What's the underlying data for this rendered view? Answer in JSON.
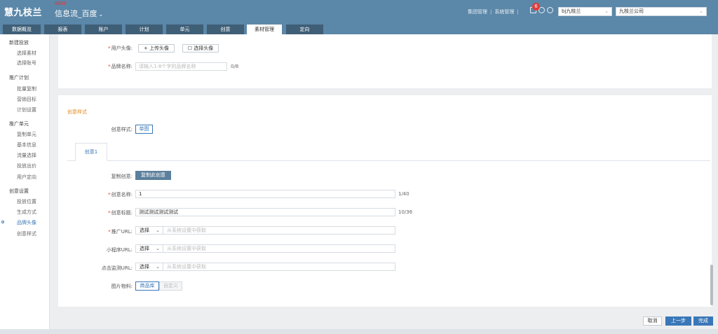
{
  "header": {
    "logo": "慧九枝兰",
    "hot_badge": "NEW",
    "product": "信息流_百度",
    "links": [
      "集团管理",
      "系统管理"
    ],
    "notification_count": "6",
    "account_select": "bj九枝兰",
    "company_select": "九枝兰公司"
  },
  "tabs": [
    "数据概览",
    "报表",
    "账户",
    "计划",
    "单元",
    "创意",
    "素材管理",
    "定向"
  ],
  "active_tab": "素材管理",
  "sidebar": {
    "groups": [
      {
        "label": "新建投放",
        "children": [
          "选择素材",
          "选择账号"
        ]
      },
      {
        "label": "推广计划",
        "children": [
          "批量复制",
          "营销目标",
          "计划设置"
        ]
      },
      {
        "label": "推广单元",
        "children": [
          "复制单元",
          "基本信息",
          "流量选择",
          "投放出价",
          "用户定向"
        ]
      },
      {
        "label": "创意设置",
        "children": [
          "投放位置",
          "生成方式",
          "品牌头像",
          "创意样式"
        ]
      }
    ],
    "active_item": "品牌头像"
  },
  "brand": {
    "avatar_label": "用户头像:",
    "upload_label": "+ 上传头像",
    "choose_label": "☐ 选择头像",
    "name_label": "品牌名称:",
    "name_placeholder": "请输入1-8个字的品牌名称",
    "name_counter": "0/8"
  },
  "creative": {
    "section_title": "创意样式",
    "style_label": "创意样式:",
    "style_value": "单图",
    "subtab": "创意1",
    "copy_label": "复制创意:",
    "copy_button": "复制此创意",
    "name_label": "创意名称:",
    "name_value": "1",
    "name_counter": "1/40",
    "title_label": "创意标题:",
    "title_value": "测试测试测试测试",
    "title_counter": "10/36",
    "promo_url_label": "推广URL:",
    "mini_url_label": "小程序URL:",
    "click_url_label": "点击监测URL:",
    "url_select": "选择",
    "url_placeholder": "从系统设置中获取",
    "image_label": "图片物料:",
    "image_tab_on": "商品库",
    "image_tab_off": "自定义"
  },
  "footer": {
    "cancel": "取消",
    "prev": "上一步",
    "done": "完成"
  }
}
